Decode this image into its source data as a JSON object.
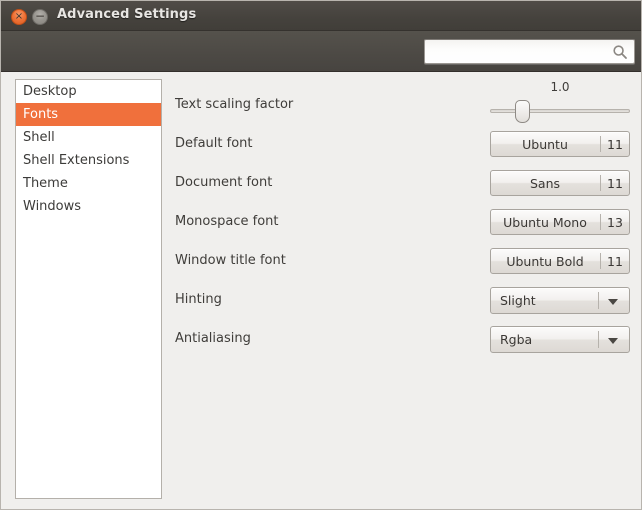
{
  "window": {
    "title": "Advanced Settings",
    "close_label": "×",
    "minimize_label": "−",
    "accent_color": "#f0703c",
    "titlebar_color": "#45423d"
  },
  "toolbar": {
    "search": {
      "value": "",
      "placeholder": "",
      "icon": "search-icon"
    }
  },
  "sidebar": {
    "items": [
      {
        "label": "Desktop",
        "selected": false
      },
      {
        "label": "Fonts",
        "selected": true
      },
      {
        "label": "Shell",
        "selected": false
      },
      {
        "label": "Shell Extensions",
        "selected": false
      },
      {
        "label": "Theme",
        "selected": false
      },
      {
        "label": "Windows",
        "selected": false
      }
    ]
  },
  "settings": {
    "rows": [
      {
        "label": "Text scaling factor",
        "type": "slider",
        "value": "1.0",
        "percent": 22
      },
      {
        "label": "Default font",
        "type": "font-button",
        "font_name": "Ubuntu",
        "font_size": "11"
      },
      {
        "label": "Document font",
        "type": "font-button",
        "font_name": "Sans",
        "font_size": "11"
      },
      {
        "label": "Monospace font",
        "type": "font-button",
        "font_name": "Ubuntu Mono",
        "font_size": "13"
      },
      {
        "label": "Window title font",
        "type": "font-button",
        "font_name": "Ubuntu Bold",
        "font_size": "11"
      },
      {
        "label": "Hinting",
        "type": "dropdown",
        "value": "Slight",
        "arrow": "chevron-down-icon"
      },
      {
        "label": "Antialiasing",
        "type": "dropdown",
        "value": "Rgba",
        "arrow": "chevron-down-icon"
      }
    ]
  }
}
